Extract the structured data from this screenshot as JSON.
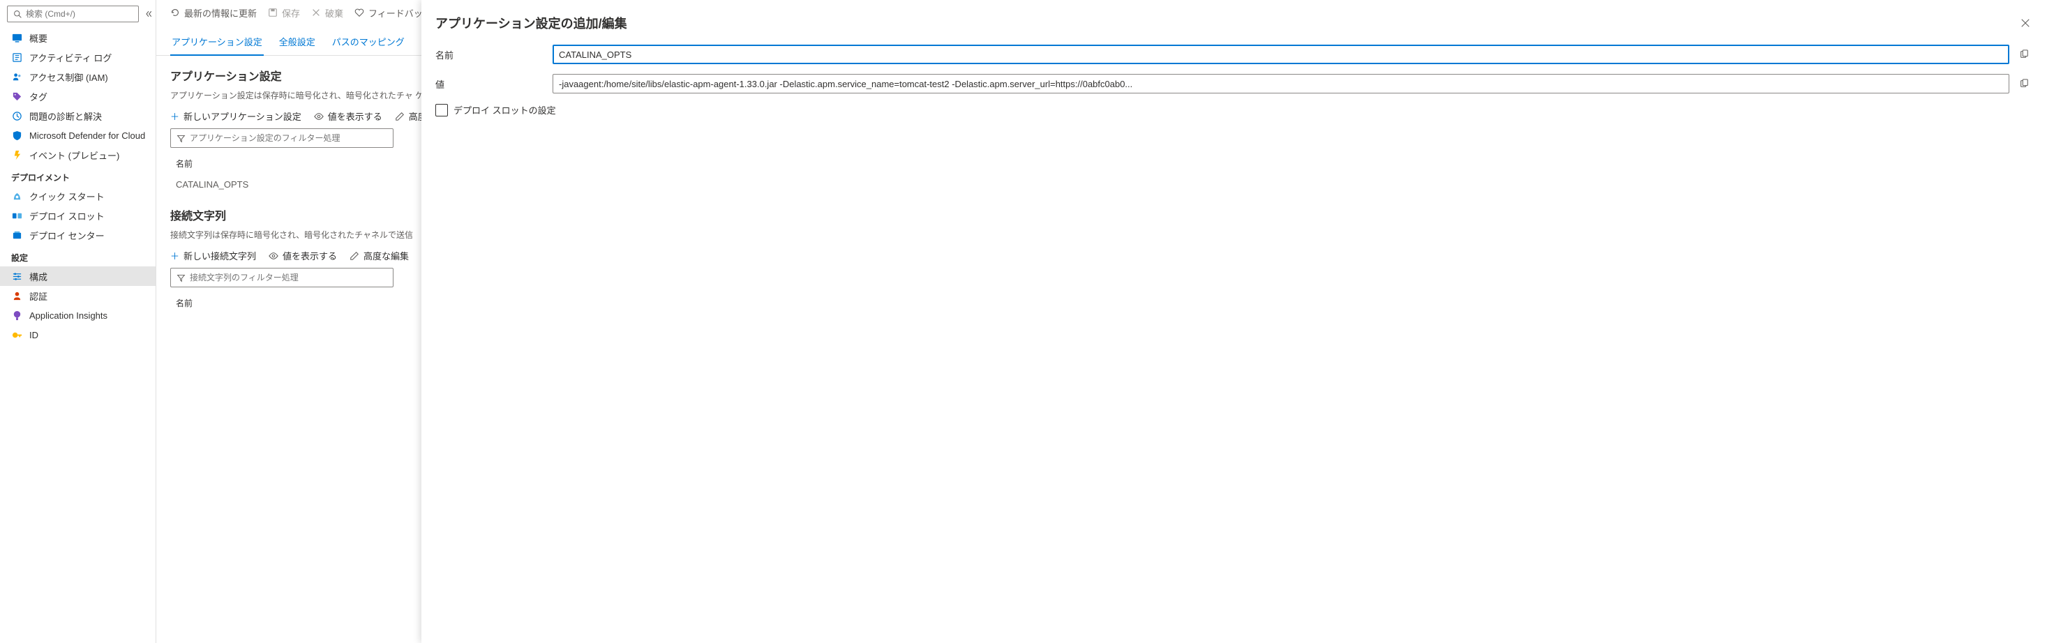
{
  "sidebar": {
    "search_placeholder": "検索 (Cmd+/)",
    "items_top": [
      {
        "label": "概要",
        "icon": "overview-icon",
        "color": "#0078d4"
      },
      {
        "label": "アクティビティ ログ",
        "icon": "activity-log-icon",
        "color": "#0078d4"
      },
      {
        "label": "アクセス制御 (IAM)",
        "icon": "access-control-icon",
        "color": "#0078d4"
      },
      {
        "label": "タグ",
        "icon": "tags-icon",
        "color": "#7e4cc1"
      },
      {
        "label": "問題の診断と解決",
        "icon": "diagnose-icon",
        "color": "#0078d4"
      },
      {
        "label": "Microsoft Defender for Cloud",
        "icon": "defender-icon",
        "color": "#0078d4"
      },
      {
        "label": "イベント (プレビュー)",
        "icon": "events-icon",
        "color": "#ffb900"
      }
    ],
    "section_deploy": "デプロイメント",
    "items_deploy": [
      {
        "label": "クイック スタート",
        "icon": "quickstart-icon",
        "color": "#0078d4"
      },
      {
        "label": "デプロイ スロット",
        "icon": "deploy-slot-icon",
        "color": "#0078d4"
      },
      {
        "label": "デプロイ センター",
        "icon": "deploy-center-icon",
        "color": "#0078d4"
      }
    ],
    "section_settings": "設定",
    "items_settings": [
      {
        "label": "構成",
        "icon": "configuration-icon",
        "color": "#0078d4",
        "selected": true
      },
      {
        "label": "認証",
        "icon": "authentication-icon",
        "color": "#d83b01"
      },
      {
        "label": "Application Insights",
        "icon": "app-insights-icon",
        "color": "#7e4cc1"
      },
      {
        "label": "ID",
        "icon": "identity-icon",
        "color": "#ffb900"
      }
    ]
  },
  "toolbar": {
    "refresh": "最新の情報に更新",
    "save": "保存",
    "discard": "破棄",
    "feedback": "フィードバッ"
  },
  "tabs": {
    "app_settings": "アプリケーション設定",
    "general": "全般設定",
    "path_mappings": "パスのマッピング"
  },
  "app_settings_section": {
    "heading": "アプリケーション設定",
    "desc": "アプリケーション設定は保存時に暗号化され、暗号化されたチャ\nケーションでアクセスするための環境変数として公開されます。",
    "add_new": "新しいアプリケーション設定",
    "show_values": "値を表示する",
    "advanced_edit": "高度",
    "filter_placeholder": "アプリケーション設定のフィルター処理",
    "col_name": "名前",
    "rows": [
      {
        "name": "CATALINA_OPTS"
      }
    ]
  },
  "conn_strings_section": {
    "heading": "接続文字列",
    "desc": "接続文字列は保存時に暗号化され、暗号化されたチャネルで送信",
    "add_new": "新しい接続文字列",
    "show_values": "値を表示する",
    "advanced_edit": "高度な編集",
    "filter_placeholder": "接続文字列のフィルター処理",
    "col_name": "名前"
  },
  "flyout": {
    "title": "アプリケーション設定の追加/編集",
    "label_name": "名前",
    "field_name": "CATALINA_OPTS",
    "label_value": "値",
    "field_value": "-javaagent:/home/site/libs/elastic-apm-agent-1.33.0.jar -Delastic.apm.service_name=tomcat-test2 -Delastic.apm.server_url=https://0abfc0ab0...",
    "checkbox_deploy_slot": "デプロイ スロットの設定"
  }
}
